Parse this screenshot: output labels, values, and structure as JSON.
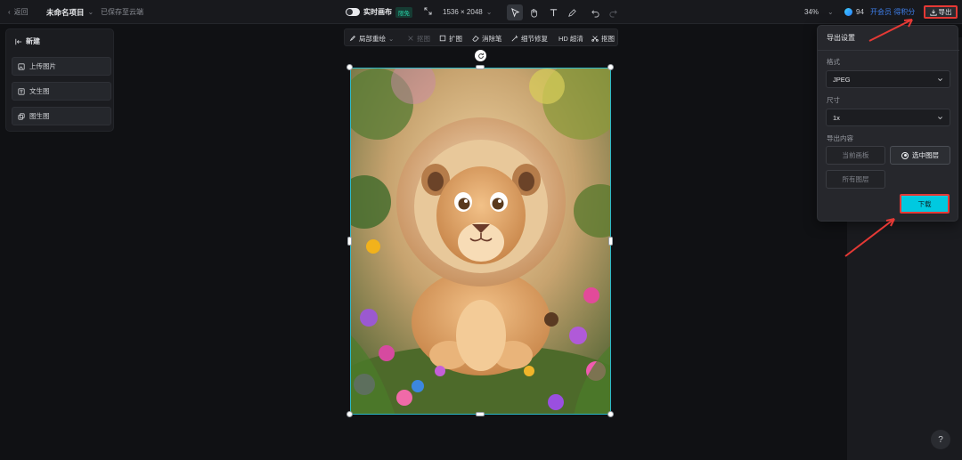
{
  "topbar": {
    "back_label": "返回",
    "project_name": "未命名项目",
    "save_status": "已保存至云端",
    "realtime_label": "实时画布",
    "realtime_badge": "限免",
    "canvas_size": "1536 × 2048",
    "zoom": "34%",
    "credits": "94",
    "member_link": "开会员 得积分",
    "export_label": "导出"
  },
  "left_panel": {
    "title": "新建",
    "items": [
      {
        "label": "上传图片",
        "icon": "upload-image-icon"
      },
      {
        "label": "文生图",
        "icon": "text-to-image-icon"
      },
      {
        "label": "图生图",
        "icon": "image-to-image-icon"
      }
    ]
  },
  "canvas_toolbar": {
    "items": [
      {
        "label": "局部重绘",
        "icon": "brush-icon",
        "enabled": true
      },
      {
        "label": "抠图",
        "icon": "cutout-icon",
        "enabled": false
      },
      {
        "label": "扩图",
        "icon": "expand-icon",
        "enabled": true
      },
      {
        "label": "消除笔",
        "icon": "eraser-icon",
        "enabled": true
      },
      {
        "label": "细节修复",
        "icon": "magic-wand-icon",
        "enabled": true
      },
      {
        "label": "HD 超清",
        "icon": "hd-icon",
        "enabled": true
      },
      {
        "label": "抠图",
        "icon": "cutout-icon",
        "enabled": true
      }
    ]
  },
  "export_panel": {
    "title": "导出设置",
    "format_label": "格式",
    "format_value": "JPEG",
    "size_label": "尺寸",
    "size_value": "1x",
    "content_label": "导出内容",
    "options": {
      "current_canvas": "当前画板",
      "selected_layer": "选中图层",
      "all_layers": "所有图层"
    },
    "selected_option": "选中图层",
    "download_label": "下载"
  },
  "help_label": "?",
  "colors": {
    "accent_cyan": "#00c9e0",
    "highlight_red": "#e53935",
    "selection_border": "#2bb8c9",
    "link_blue": "#3d7de8",
    "badge_green": "#27d1a6"
  }
}
